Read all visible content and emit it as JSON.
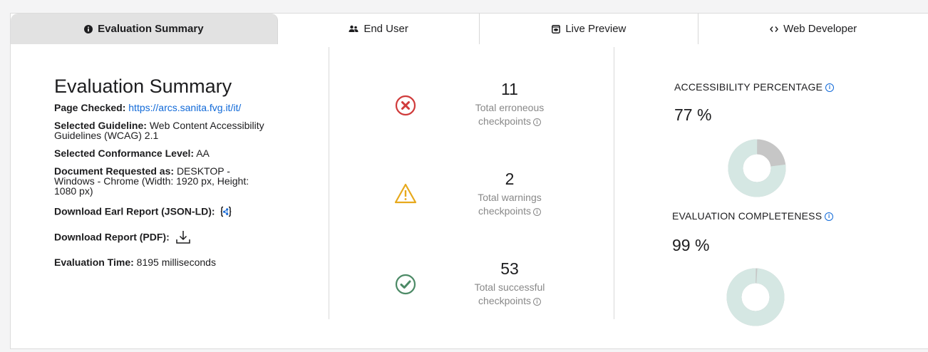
{
  "tabs": [
    {
      "label": "Evaluation Summary",
      "icon": "info-circle-icon",
      "active": true
    },
    {
      "label": "End User",
      "icon": "users-icon",
      "active": false
    },
    {
      "label": "Live Preview",
      "icon": "preview-icon",
      "active": false
    },
    {
      "label": "Web Developer",
      "icon": "code-icon",
      "active": false
    }
  ],
  "summary": {
    "title": "Evaluation Summary",
    "page_checked_label": "Page Checked:",
    "page_checked_url": "https://arcs.sanita.fvg.it/it/",
    "guideline_label": "Selected Guideline:",
    "guideline_value_1": "Web Content Accessibility",
    "guideline_value_2": "Guidelines (WCAG) 2.1",
    "conformance_label": "Selected Conformance Level:",
    "conformance_value": "AA",
    "document_label": "Document Requested as:",
    "document_value_1": "DESKTOP -",
    "document_value_2": "Windows - Chrome (Width: 1920 px, Height:",
    "document_value_3": "1080 px)",
    "earl_label": "Download Earl Report (JSON-LD):",
    "pdf_label": "Download Report (PDF):",
    "time_label": "Evaluation Time:",
    "time_value": "8195 milliseconds"
  },
  "checkpoints": [
    {
      "count": "11",
      "line1": "Total erroneous",
      "line2": "checkpoints",
      "icon": "error-x-icon",
      "color": "#d03b3b"
    },
    {
      "count": "2",
      "line1": "Total warnings",
      "line2": "checkpoints",
      "icon": "warning-triangle-icon",
      "color": "#e7a91c"
    },
    {
      "count": "53",
      "line1": "Total successful",
      "line2": "checkpoints",
      "icon": "success-check-icon",
      "color": "#4c8a66"
    }
  ],
  "metrics": {
    "accessibility_title": "ACCESSIBILITY PERCENTAGE",
    "accessibility_value": "77 %",
    "accessibility_fraction": 0.77,
    "completeness_title": "EVALUATION COMPLETENESS",
    "completeness_value": "99 %",
    "completeness_fraction": 0.99,
    "filled_color": "#d5e7e3",
    "remaining_color": "#c6c6c6"
  },
  "info_glyph": "i"
}
